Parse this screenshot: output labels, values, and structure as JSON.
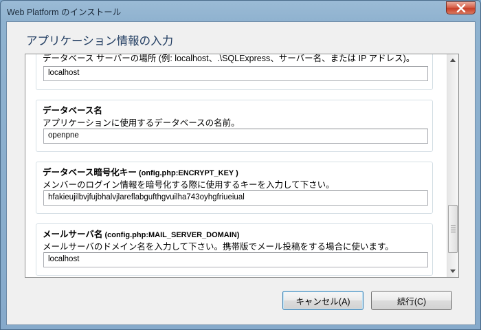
{
  "window": {
    "title": "Web Platform のインストール"
  },
  "page": {
    "title": "アプリケーション情報の入力"
  },
  "groups": [
    {
      "title": "",
      "title_tech": "",
      "description": "データベース サーバーの場所 (例: localhost、.\\SQLExpress、サーバー名、または IP アドレス)。",
      "value": "localhost"
    },
    {
      "title": "データベース名",
      "title_tech": "",
      "description": "アプリケーションに使用するデータベースの名前。",
      "value": "openpne"
    },
    {
      "title": "データベース暗号化キー",
      "title_tech": " (onfig.php:ENCRYPT_KEY )",
      "description": "メンバーのログイン情報を暗号化する際に使用するキーを入力して下さい。",
      "value": "hfakieujilbvjfujbhalvjlareflabgufthgvuilha743oyhgfriueiual"
    },
    {
      "title": "メールサーバ名",
      "title_tech": " (config.php:MAIL_SERVER_DOMAIN)",
      "description": "メールサーバのドメイン名を入力して下さい。携帯版でメール投稿をする場合に使います。",
      "value": "localhost"
    }
  ],
  "scrollbar": {
    "position": 0.92
  },
  "buttons": {
    "cancel": "キャンセル(A)",
    "next": "続行(C)"
  }
}
